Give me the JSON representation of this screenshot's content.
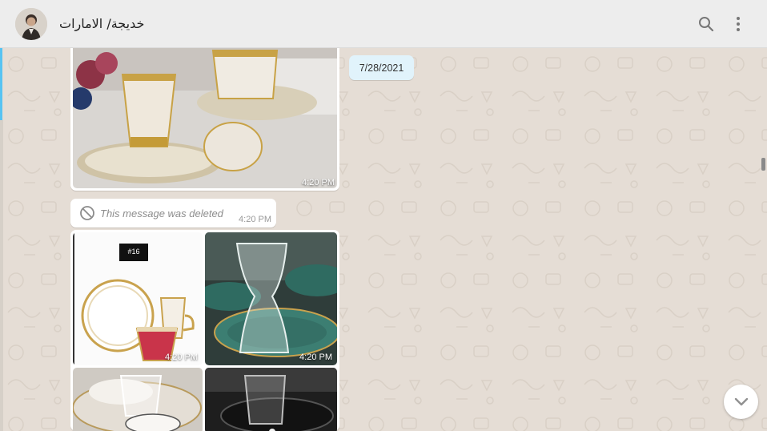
{
  "header": {
    "contact_name": "خديجة/ الامارات",
    "icons": [
      "avatar",
      "search-icon",
      "menu-icon"
    ]
  },
  "chat": {
    "date_chip": "7/28/2021",
    "messages": [
      {
        "type": "image",
        "time": "4:20 PM"
      },
      {
        "type": "deleted",
        "text": "This message was deleted",
        "time": "4:20 PM"
      },
      {
        "type": "image-grid",
        "tiles": [
          {
            "badge": "#16",
            "time": "4:20 PM"
          },
          {
            "time": "4:20 PM"
          },
          {
            "time": ""
          },
          {
            "time": ""
          }
        ]
      }
    ]
  },
  "colors": {
    "header_bg": "#ededed",
    "chat_bg": "#e5ddd5",
    "date_chip_bg": "#e1f3fb",
    "accent": "#57c3f2"
  }
}
